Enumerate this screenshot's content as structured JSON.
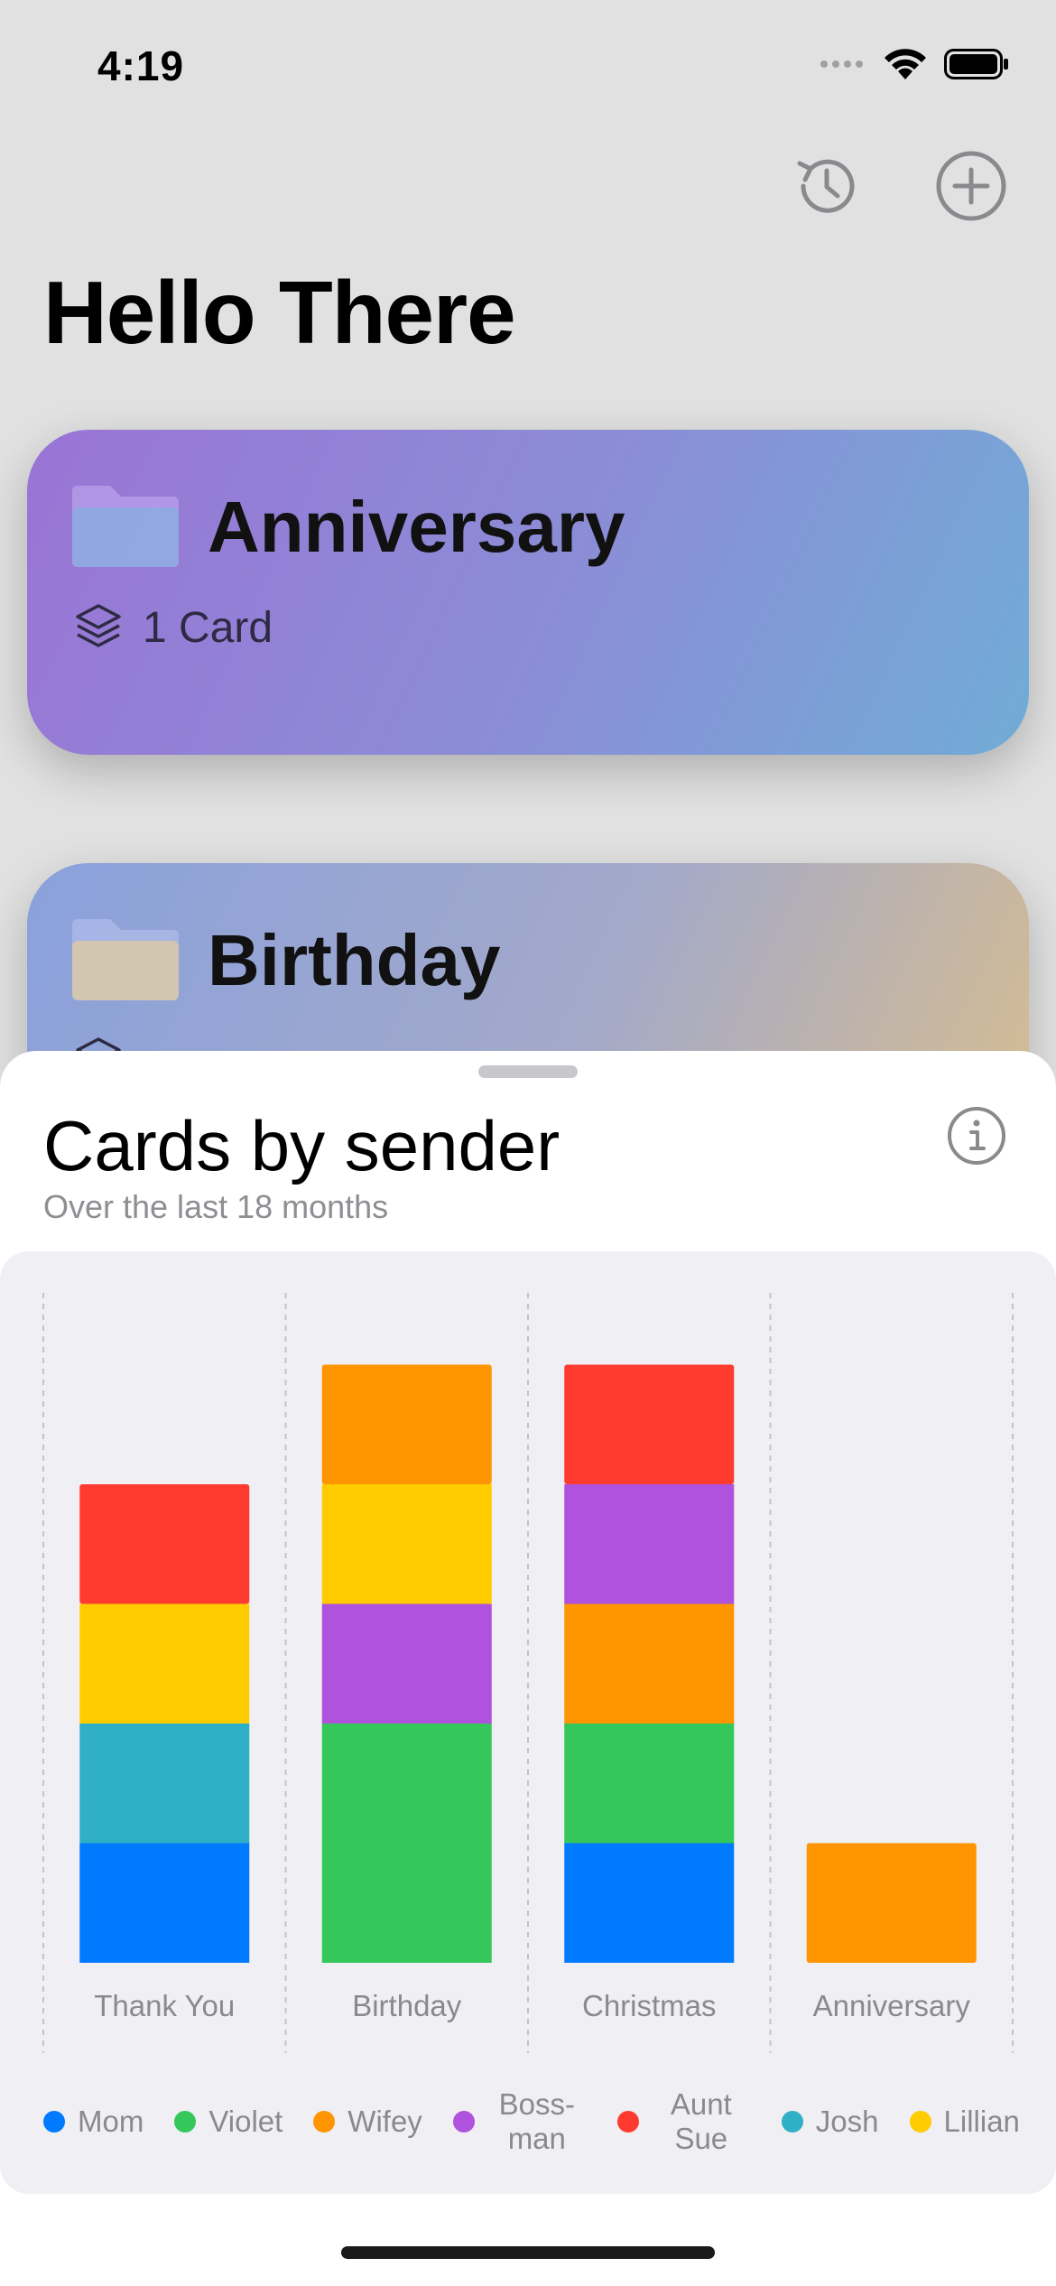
{
  "status_bar": {
    "time": "4:19"
  },
  "toolbar": {
    "history_icon": "clock-history-icon",
    "add_icon": "plus-circle-icon"
  },
  "page": {
    "title": "Hello There"
  },
  "folders": [
    {
      "name": "Anniversary",
      "count_label": "1 Card"
    },
    {
      "name": "Birthday",
      "count_label": ""
    }
  ],
  "sheet": {
    "title": "Cards by sender",
    "subtitle": "Over the last 18 months",
    "info_icon": "info-circle-icon"
  },
  "chart_data": {
    "type": "bar",
    "stacked": true,
    "categories": [
      "Thank You",
      "Birthday",
      "Christmas",
      "Anniversary"
    ],
    "ylim": [
      0,
      6
    ],
    "series": [
      {
        "name": "Mom",
        "color": "#007aff",
        "values": [
          1,
          0,
          1,
          0
        ]
      },
      {
        "name": "Violet",
        "color": "#34c759",
        "values": [
          0,
          2,
          1,
          0
        ]
      },
      {
        "name": "Wifey",
        "color": "#ff9500",
        "values": [
          0,
          1,
          1,
          1
        ]
      },
      {
        "name": "Boss-man",
        "color": "#af52de",
        "values": [
          0,
          1,
          1,
          0
        ]
      },
      {
        "name": "Aunt Sue",
        "color": "#ff3b30",
        "values": [
          1,
          0,
          1,
          0
        ]
      },
      {
        "name": "Josh",
        "color": "#30b0c7",
        "values": [
          1,
          0,
          0,
          0
        ]
      },
      {
        "name": "Lillian",
        "color": "#ffcc00",
        "values": [
          1,
          1,
          0,
          0
        ]
      }
    ],
    "stack_order": [
      [
        "Mom",
        "Josh",
        "Lillian",
        "Aunt Sue"
      ],
      [
        "Violet",
        "Boss-man",
        "Lillian",
        "Mom",
        "Wifey"
      ],
      [
        "Mom",
        "Violet",
        "Wifey",
        "Boss-man",
        "Aunt Sue"
      ],
      [
        "Wifey"
      ]
    ],
    "legend_position": "bottom",
    "gridlines": "vertical-dashed"
  }
}
